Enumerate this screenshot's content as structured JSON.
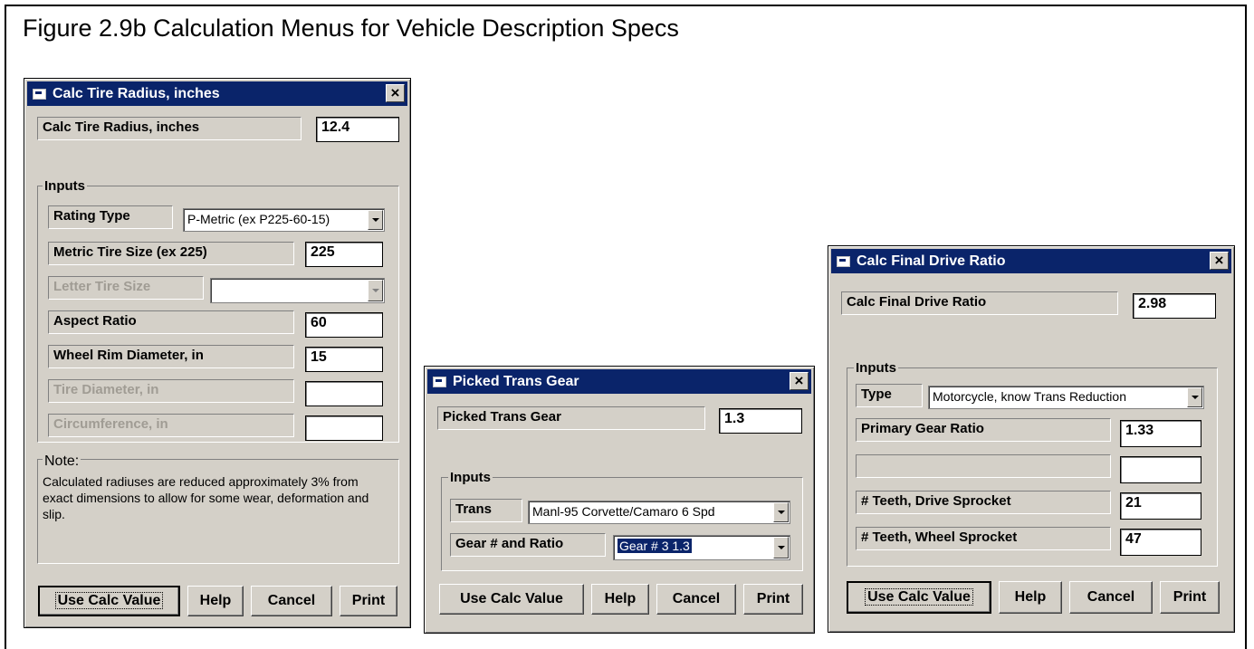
{
  "figure": {
    "title": "Figure 2.9b  Calculation Menus for Vehicle Description Specs"
  },
  "tire_window": {
    "title": "Calc Tire Radius, inches",
    "result_label": "Calc Tire Radius, inches",
    "result_value": "12.4",
    "inputs_caption": "Inputs",
    "rating_type_label": "Rating Type",
    "rating_type_value": "P-Metric (ex P225-60-15)",
    "metric_size_label": "Metric Tire Size (ex 225)",
    "metric_size_value": "225",
    "letter_size_label": "Letter Tire Size",
    "letter_size_value": "",
    "aspect_label": "Aspect Ratio",
    "aspect_value": "60",
    "rim_label": "Wheel Rim Diameter, in",
    "rim_value": "15",
    "tire_dia_label": "Tire Diameter, in",
    "tire_dia_value": "",
    "circ_label": "Circumference, in",
    "circ_value": "",
    "note_caption": "Note:",
    "note_text": "Calculated radiuses are reduced approximately 3% from exact dimensions to allow for some wear, deformation and slip.",
    "buttons": {
      "use": "Use Calc Value",
      "help": "Help",
      "cancel": "Cancel",
      "print": "Print"
    }
  },
  "gear_window": {
    "title": "Picked Trans Gear",
    "result_label": "Picked Trans Gear",
    "result_value": "1.3",
    "inputs_caption": "Inputs",
    "trans_label": "Trans",
    "trans_value": "Manl-95 Corvette/Camaro 6 Spd",
    "gear_label": "Gear # and Ratio",
    "gear_value": "Gear # 3  1.3",
    "buttons": {
      "use": "Use Calc Value",
      "help": "Help",
      "cancel": "Cancel",
      "print": "Print"
    }
  },
  "final_window": {
    "title": "Calc Final Drive Ratio",
    "result_label": "Calc Final Drive Ratio",
    "result_value": "2.98",
    "inputs_caption": "Inputs",
    "type_label": "Type",
    "type_value": "Motorcycle, know Trans Reduction",
    "primary_label": "Primary Gear Ratio",
    "primary_value": "1.33",
    "blank_label": "",
    "blank_value": "",
    "drive_label": "# Teeth, Drive Sprocket",
    "drive_value": "21",
    "wheel_label": "# Teeth, Wheel Sprocket",
    "wheel_value": "47",
    "buttons": {
      "use": "Use Calc Value",
      "help": "Help",
      "cancel": "Cancel",
      "print": "Print"
    }
  },
  "colors": {
    "titlebar": "#0a246a",
    "face": "#d4d0c8",
    "selection": "#0a246a"
  }
}
